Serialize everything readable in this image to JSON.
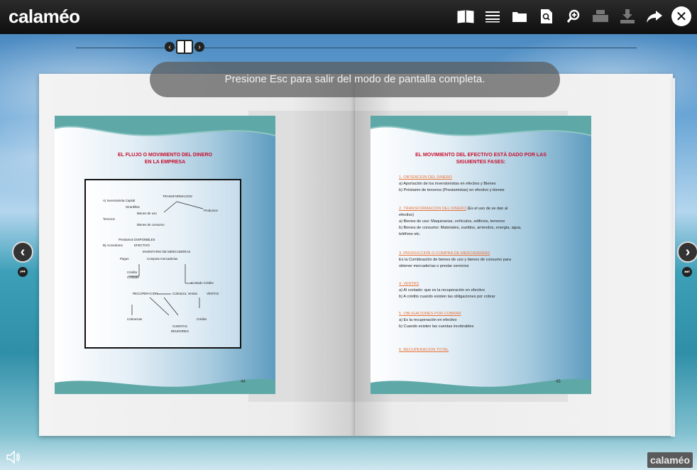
{
  "app": {
    "logo": "calaméo",
    "brand_badge": "calaméo"
  },
  "toolbar": {
    "icons": [
      "book-view-icon",
      "list-view-icon",
      "folder-icon",
      "search-doc-icon",
      "zoom-icon",
      "print-icon",
      "download-icon",
      "share-icon",
      "close-icon"
    ],
    "book_view": "📖",
    "list_view": "≡",
    "folder": "▬",
    "search_doc": "⌕",
    "zoom": "⚲",
    "print": "▭",
    "download": "⇩",
    "share": "➦",
    "close": "✕"
  },
  "nav": {
    "prev": "‹",
    "next": "›"
  },
  "toast": "Presione Esc para salir del modo de pantalla completa.",
  "left_slide": {
    "title_line1": "EL FLUJO O MOVIMIENTO DEL DINERO",
    "title_line2": "EN LA EMPRESA",
    "page_number": "44",
    "diagram": {
      "t1": "A) Inversionista  Capital",
      "t2": "TRANSFORMACION",
      "t3": "Girardillas",
      "t4": "Bienes de uso",
      "t5": "Productos",
      "t6": "Terceros",
      "t7": "Bienes de consumo",
      "t8": "Prestamos DISPONIBLES",
      "t9": "B) Acreedores",
      "t10": "EFECTIVO",
      "t11": "INVENTARIO DE MERCADERIAS",
      "t12": "Pagos",
      "t13": "Compras mercaderias",
      "t14": "Crédito",
      "t15": "Contado",
      "t16": "Contado Crédito",
      "t17": "RECUPERACION",
      "t18": "Cobranza, Ventas",
      "t19": "VENTAS",
      "t20": "Cobranzas",
      "t21": "Crédito",
      "t22": "CUENTAS",
      "t23": "DEUDORES"
    }
  },
  "right_slide": {
    "title_line1": "EL MOVIMIENTO DEL EFECTIVO ESTÁ DADO POR LAS",
    "title_line2": "SIGUIENTES FASES:",
    "page_number": "45",
    "sections": [
      {
        "heading": "1.  OBTENCION DEL DINERO",
        "heading_tail": "",
        "lines": [
          "a) Aportación de los inversionistas en efectivo y Bienes",
          "b) Préstamo de terceros (Prestamistas) en efectivo y bienes"
        ]
      },
      {
        "heading": "2.  TRANSFORMACION DEL DINERO",
        "heading_tail": " (Es el uso de se dan al",
        "lines": [
          "efectivo)",
          "a) Bienes de uso: Maquinarias, vehículos, edificios, terrenos",
          "b) Bienes de consumo: Materiales, sueldos, arriendos, energía, agua,",
          "teléfono etc."
        ]
      },
      {
        "heading": "3.  PRODUCCION O COMPRA DE MERCADERIAS",
        "heading_tail": "",
        "lines": [
          "Es la Combinación de bienes de uso y bienes de consumo para",
          "obtener mercaderías o prestar servicios"
        ]
      },
      {
        "heading": "4.  VENTAS",
        "heading_tail": "",
        "lines": [
          "a) Al contado: que es la recuperación en efectivo",
          "b) A crédito cuando existen las obligaciones por cobrar"
        ]
      },
      {
        "heading": "5.  OBLIGACIONES POR COBRAR",
        "heading_tail": "",
        "lines": [
          "a) Es la recuperación en efectivo",
          "b) Cuando existen las cuentas incobrables"
        ]
      },
      {
        "heading": "6.  RECUPERACION TOTAL",
        "heading_tail": "",
        "lines": []
      }
    ]
  },
  "side_nav": {
    "prev_page": "‹",
    "next_page": "›",
    "first_page": "⏮",
    "last_page": "⏭"
  },
  "sound_icon": "🔈"
}
